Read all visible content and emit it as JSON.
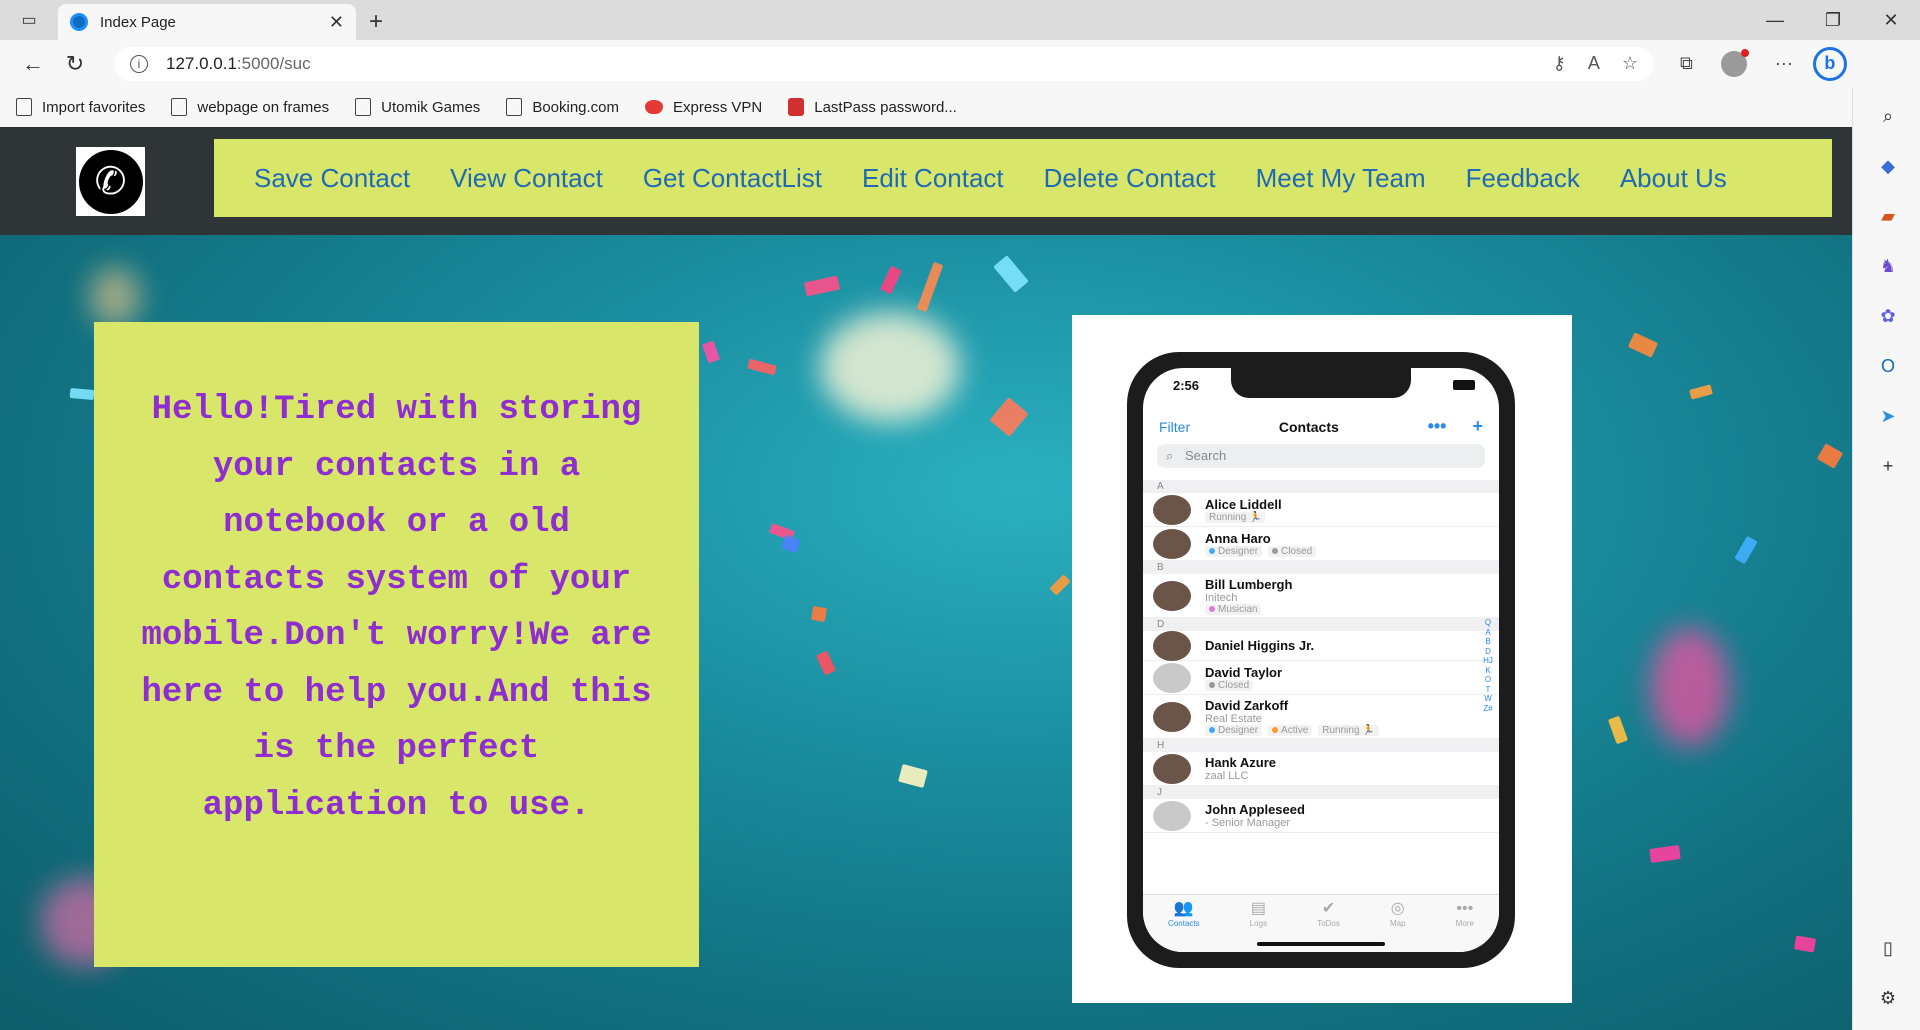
{
  "browser": {
    "tab_title": "Index Page",
    "url_host": "127.0.0.1",
    "url_rest": ":5000/suc",
    "favorites": [
      "Import favorites",
      "webpage on frames",
      "Utomik Games",
      "Booking.com",
      "Express VPN",
      "LastPass password..."
    ]
  },
  "nav": {
    "items": [
      "Save Contact",
      "View Contact",
      "Get ContactList",
      "Edit Contact",
      "Delete Contact",
      "Meet My Team",
      "Feedback",
      "About Us"
    ]
  },
  "hero": {
    "text": "Hello!Tired with storing your contacts in a notebook or a old contacts system of your mobile.Don't worry!We are here to help you.And this is the perfect application to use."
  },
  "phone": {
    "time": "2:56",
    "filter": "Filter",
    "title": "Contacts",
    "more": "•••",
    "add": "+",
    "search_placeholder": "Search",
    "sections": [
      {
        "letter": "A",
        "rows": [
          {
            "name": "Alice Liddell",
            "sub": "",
            "tags": [
              "Running 🏃"
            ]
          },
          {
            "name": "Anna Haro",
            "sub": "",
            "tags": [
              "Designer",
              "Closed"
            ]
          }
        ]
      },
      {
        "letter": "B",
        "rows": [
          {
            "name": "Bill Lumbergh",
            "sub": "Initech",
            "tags": [
              "Musician"
            ]
          }
        ]
      },
      {
        "letter": "D",
        "rows": [
          {
            "name": "Daniel Higgins Jr.",
            "sub": "",
            "tags": []
          },
          {
            "name": "David Taylor",
            "sub": "",
            "tags": [
              "Closed"
            ]
          },
          {
            "name": "David Zarkoff",
            "sub": "Real Estate",
            "tags": [
              "Designer",
              "Active",
              "Running 🏃"
            ]
          }
        ]
      },
      {
        "letter": "H",
        "rows": [
          {
            "name": "Hank Azure",
            "sub": "zaal LLC",
            "tags": []
          }
        ]
      },
      {
        "letter": "J",
        "rows": [
          {
            "name": "John Appleseed",
            "sub": "- Senior Manager",
            "tags": []
          }
        ]
      }
    ],
    "index": "QABDHJKOTWZ#",
    "tabs": [
      "Contacts",
      "Logs",
      "ToDos",
      "Map",
      "More"
    ]
  },
  "colors": {
    "menu_bg": "#d8e66a",
    "menu_link": "#1f6ab5",
    "hero_text": "#8e2ed1",
    "navbar_bg": "#2f3437"
  }
}
